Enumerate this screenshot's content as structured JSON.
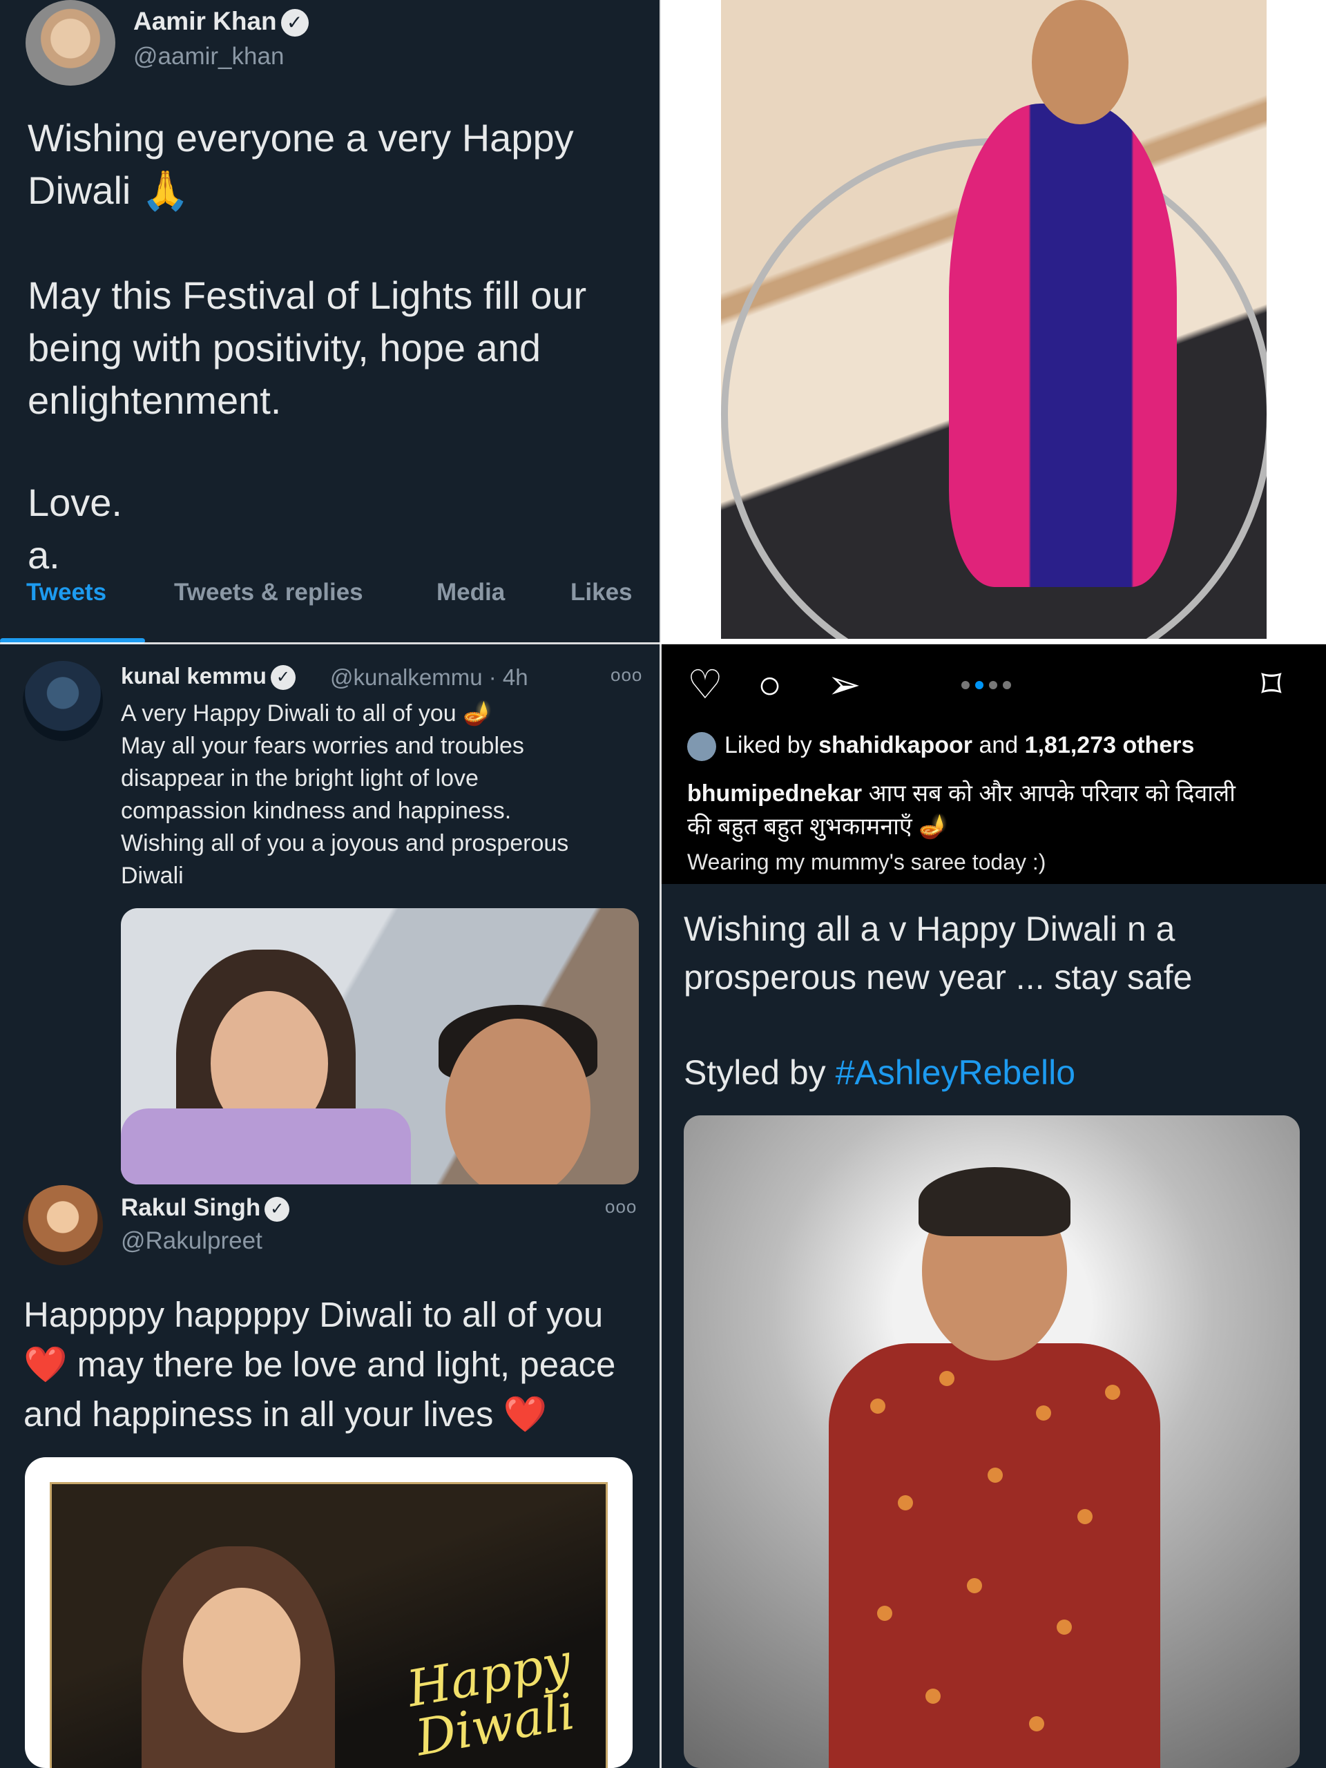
{
  "aamir": {
    "name": "Aamir Khan",
    "handle": "@aamir_khan",
    "line1": "Wishing everyone a very Happy",
    "line2": "Diwali 🙏",
    "line3": "May this Festival of Lights fill our",
    "line4": "being with positivity, hope and",
    "line5": "enlightenment.",
    "line6": "Love.",
    "line7": "a.",
    "tabs": [
      "Tweets",
      "Tweets & replies",
      "Media",
      "Likes"
    ]
  },
  "kunal": {
    "name": "kunal kemmu",
    "handle": "@kunalkemmu · 4h",
    "more": "ooo",
    "lines": [
      "A very Happy Diwali to all of you 🪔",
      "May all your fears worries and troubles",
      "disappear in the bright light of love",
      "compassion kindness and happiness.",
      "Wishing all of you a joyous and prosperous",
      "Diwali"
    ]
  },
  "rakul": {
    "name": "Rakul Singh",
    "handle": "@Rakulpreet",
    "more": "ooo",
    "line1": "Happppy happppy Diwali to all of you",
    "line2": "❤️ may there be love and light, peace",
    "line3": "and happiness in all your lives ❤️",
    "image_text_1": "Happy",
    "image_text_2": "Diwali"
  },
  "instagram": {
    "liked_prefix": "Liked by",
    "liked_user": "shahidkapoor",
    "liked_mid": "and",
    "liked_count": "1,81,273 others",
    "caption_user": "bhumipednekar",
    "caption_hindi_1": "आप सब को और आपके परिवार को दिवाली",
    "caption_hindi_2": "की बहुत बहुत शुभकामनाएँ 🪔",
    "caption_2": "Wearing my mummy's saree today :)"
  },
  "salman": {
    "line1": "Wishing all a v Happy Diwali n a",
    "line2": "prosperous new year ... stay safe",
    "styled_prefix": "Styled by",
    "styled_tag": "#AshleyRebello"
  },
  "icons": {
    "heart": "♡",
    "comment": "○",
    "share": "➢",
    "bookmark": "⌑",
    "check": "✓",
    "red_heart_color": "#e0245e"
  },
  "colors": {
    "twitter_bg": "#15202b",
    "twitter_blue": "#1d9bf0",
    "instagram_bg": "#000000"
  }
}
